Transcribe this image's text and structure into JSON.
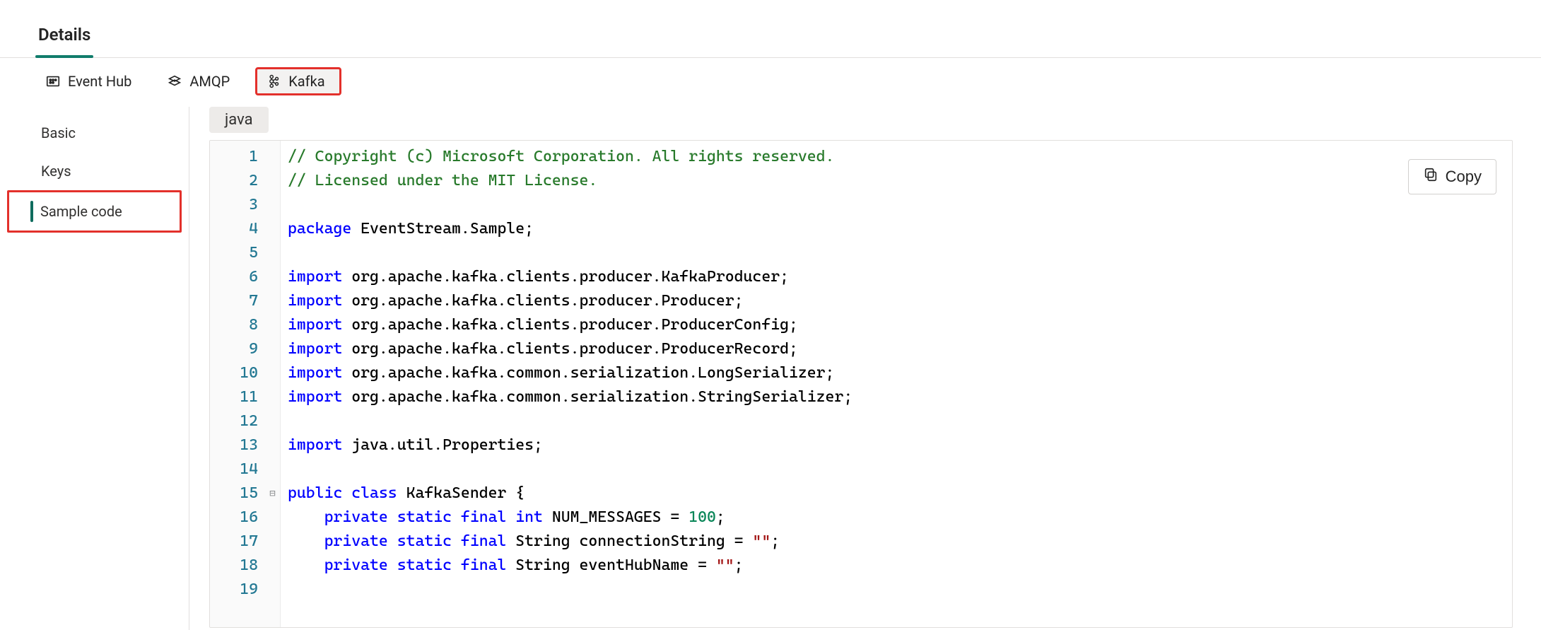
{
  "topTabs": {
    "details": "Details"
  },
  "protocolTabs": {
    "eventhub": "Event Hub",
    "amqp": "AMQP",
    "kafka": "Kafka"
  },
  "sidebar": {
    "basic": "Basic",
    "keys": "Keys",
    "sample": "Sample code"
  },
  "language": {
    "label": "java"
  },
  "actions": {
    "copy": "Copy"
  },
  "code": {
    "lines": [
      [
        [
          "com",
          "// Copyright (c) Microsoft Corporation. All rights reserved."
        ]
      ],
      [
        [
          "com",
          "// Licensed under the MIT License."
        ]
      ],
      [],
      [
        [
          "kw",
          "package"
        ],
        [
          "id",
          " EventStream.Sample;"
        ]
      ],
      [],
      [
        [
          "kw",
          "import"
        ],
        [
          "id",
          " org.apache.kafka.clients.producer.KafkaProducer;"
        ]
      ],
      [
        [
          "kw",
          "import"
        ],
        [
          "id",
          " org.apache.kafka.clients.producer.Producer;"
        ]
      ],
      [
        [
          "kw",
          "import"
        ],
        [
          "id",
          " org.apache.kafka.clients.producer.ProducerConfig;"
        ]
      ],
      [
        [
          "kw",
          "import"
        ],
        [
          "id",
          " org.apache.kafka.clients.producer.ProducerRecord;"
        ]
      ],
      [
        [
          "kw",
          "import"
        ],
        [
          "id",
          " org.apache.kafka.common.serialization.LongSerializer;"
        ]
      ],
      [
        [
          "kw",
          "import"
        ],
        [
          "id",
          " org.apache.kafka.common.serialization.StringSerializer;"
        ]
      ],
      [],
      [
        [
          "kw",
          "import"
        ],
        [
          "id",
          " java.util.Properties;"
        ]
      ],
      [],
      [
        [
          "kw",
          "public"
        ],
        [
          "id",
          " "
        ],
        [
          "kw",
          "class"
        ],
        [
          "id",
          " KafkaSender {"
        ]
      ],
      [
        [
          "id",
          "    "
        ],
        [
          "kw",
          "private"
        ],
        [
          "id",
          " "
        ],
        [
          "kw",
          "static"
        ],
        [
          "id",
          " "
        ],
        [
          "kw",
          "final"
        ],
        [
          "id",
          " "
        ],
        [
          "kw",
          "int"
        ],
        [
          "id",
          " NUM_MESSAGES = "
        ],
        [
          "num",
          "100"
        ],
        [
          "id",
          ";"
        ]
      ],
      [
        [
          "id",
          "    "
        ],
        [
          "kw",
          "private"
        ],
        [
          "id",
          " "
        ],
        [
          "kw",
          "static"
        ],
        [
          "id",
          " "
        ],
        [
          "kw",
          "final"
        ],
        [
          "id",
          " String connectionString = "
        ],
        [
          "str",
          "\"\""
        ],
        [
          "id",
          ";"
        ]
      ],
      [
        [
          "id",
          "    "
        ],
        [
          "kw",
          "private"
        ],
        [
          "id",
          " "
        ],
        [
          "kw",
          "static"
        ],
        [
          "id",
          " "
        ],
        [
          "kw",
          "final"
        ],
        [
          "id",
          " String eventHubName = "
        ],
        [
          "str",
          "\"\""
        ],
        [
          "id",
          ";"
        ]
      ],
      []
    ],
    "foldMarks": {
      "15": "minus"
    }
  },
  "colors": {
    "highlightBorder": "#e3302b",
    "activeUnderline": "#107c6b",
    "sideAccent": "#0f6c5e"
  }
}
